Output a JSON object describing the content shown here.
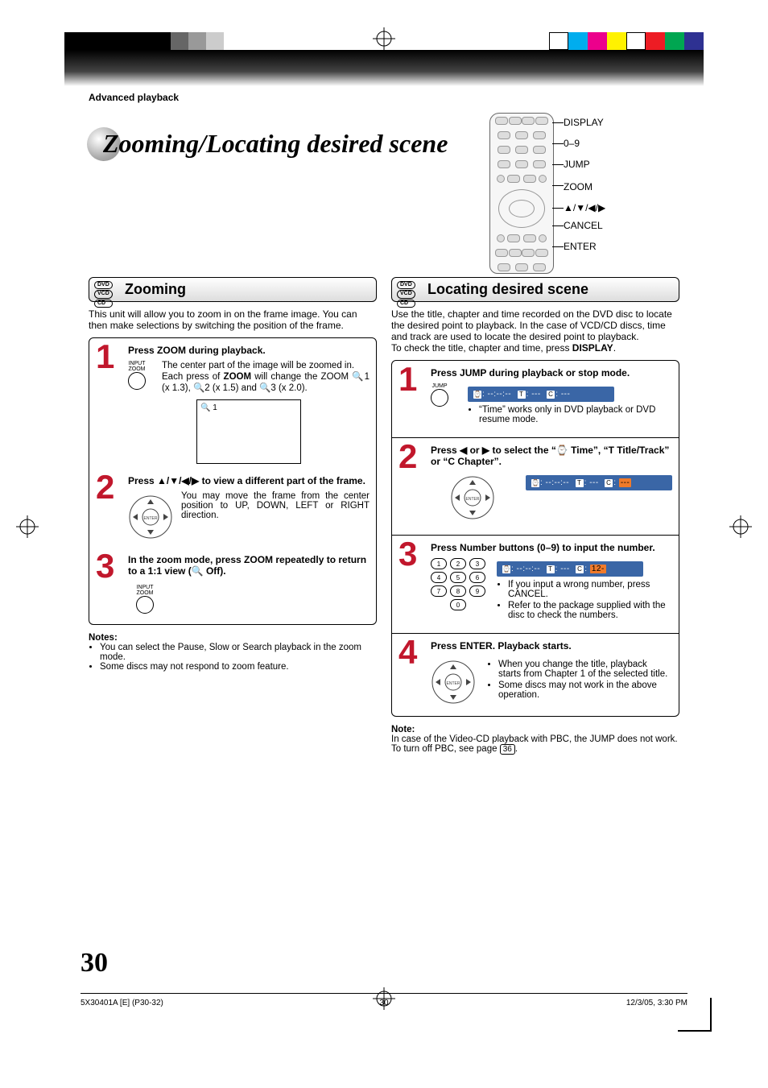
{
  "section_header": "Advanced playback",
  "page_title": "Zooming/Locating desired scene",
  "remote_labels": {
    "display": "DISPLAY",
    "digits": "0–9",
    "jump": "JUMP",
    "zoom": "ZOOM",
    "arrows": "▲/▼/◀/▶",
    "cancel": "CANCEL",
    "enter": "ENTER"
  },
  "left": {
    "badges": [
      "DVD",
      "VCD",
      "CD"
    ],
    "heading": "Zooming",
    "intro": "This unit will allow you to zoom in on the frame image. You can then make selections by switching the position of the frame.",
    "step1": {
      "head": "Press ZOOM during playback.",
      "icon_label": "INPUT\nZOOM",
      "body_pre": "The center part of the image will be zoomed in.\nEach press of ",
      "zoom_word": "ZOOM",
      "body_post": " will change the ZOOM 🔍1 (x 1.3), 🔍2 (x 1.5) and 🔍3 (x 2.0).",
      "tv_text": "🔍 1"
    },
    "step2": {
      "head": "Press ▲/▼/◀/▶ to view a different part of the frame.",
      "body": "You may move the frame from the center position to UP, DOWN, LEFT or RIGHT direction."
    },
    "step3": {
      "head": "In the zoom mode, press ZOOM repeatedly to return to a 1:1 view (🔍 Off).",
      "icon_label": "INPUT\nZOOM"
    },
    "notes_h": "Notes:",
    "notes": [
      "You can select the Pause, Slow or Search playback in the zoom mode.",
      "Some discs may not respond to zoom feature."
    ]
  },
  "right": {
    "badges": [
      "DVD",
      "VCD",
      "CD"
    ],
    "heading": "Locating desired scene",
    "intro_pre": "Use the title, chapter and time recorded on the DVD disc to locate the desired point to playback. In the case of VCD/CD discs, time and track are used to locate the desired point to playback.\nTo check the title, chapter and time, press ",
    "intro_bold": "DISPLAY",
    "step1": {
      "head": "Press JUMP during playback or stop mode.",
      "icon_label": "JUMP",
      "osd": "⌚ : --:--:--   T : ---   C : ---",
      "bullet": "“Time” works only in DVD playback or DVD resume mode."
    },
    "step2": {
      "head": "Press ◀ or ▶ to select the “⌚ Time”, “T Title/Track” or “C Chapter”.",
      "osd": "⌚ : --:--:--   T : ---   C : ---"
    },
    "step3": {
      "head": "Press Number buttons (0–9) to input the number.",
      "osd_pre": "⌚ : --:--:--   T : ---   C : ",
      "osd_hl": "12-",
      "bullets": [
        "If you input a wrong number, press CANCEL.",
        "Refer to the package supplied with the disc to check the numbers."
      ]
    },
    "step4": {
      "head": "Press ENTER. Playback starts.",
      "bullets": [
        "When you change the title, playback starts from Chapter 1 of the selected title.",
        "Some discs may not work in the above operation."
      ]
    },
    "note_h": "Note:",
    "note_pre": "In case of the Video-CD playback with PBC, the JUMP does not work. To turn off PBC, see page ",
    "note_pg": "36"
  },
  "page_number": "30",
  "footer": {
    "left": "5X30401A [E] (P30-32)",
    "center": "30",
    "right": "12/3/05, 3:30 PM"
  }
}
